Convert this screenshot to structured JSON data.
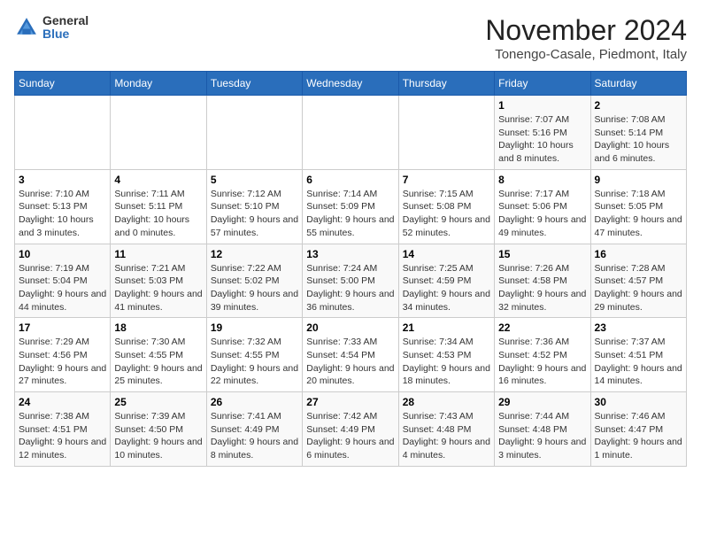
{
  "header": {
    "logo_general": "General",
    "logo_blue": "Blue",
    "month_title": "November 2024",
    "location": "Tonengo-Casale, Piedmont, Italy"
  },
  "days_of_week": [
    "Sunday",
    "Monday",
    "Tuesday",
    "Wednesday",
    "Thursday",
    "Friday",
    "Saturday"
  ],
  "weeks": [
    [
      {
        "day": "",
        "info": ""
      },
      {
        "day": "",
        "info": ""
      },
      {
        "day": "",
        "info": ""
      },
      {
        "day": "",
        "info": ""
      },
      {
        "day": "",
        "info": ""
      },
      {
        "day": "1",
        "info": "Sunrise: 7:07 AM\nSunset: 5:16 PM\nDaylight: 10 hours and 8 minutes."
      },
      {
        "day": "2",
        "info": "Sunrise: 7:08 AM\nSunset: 5:14 PM\nDaylight: 10 hours and 6 minutes."
      }
    ],
    [
      {
        "day": "3",
        "info": "Sunrise: 7:10 AM\nSunset: 5:13 PM\nDaylight: 10 hours and 3 minutes."
      },
      {
        "day": "4",
        "info": "Sunrise: 7:11 AM\nSunset: 5:11 PM\nDaylight: 10 hours and 0 minutes."
      },
      {
        "day": "5",
        "info": "Sunrise: 7:12 AM\nSunset: 5:10 PM\nDaylight: 9 hours and 57 minutes."
      },
      {
        "day": "6",
        "info": "Sunrise: 7:14 AM\nSunset: 5:09 PM\nDaylight: 9 hours and 55 minutes."
      },
      {
        "day": "7",
        "info": "Sunrise: 7:15 AM\nSunset: 5:08 PM\nDaylight: 9 hours and 52 minutes."
      },
      {
        "day": "8",
        "info": "Sunrise: 7:17 AM\nSunset: 5:06 PM\nDaylight: 9 hours and 49 minutes."
      },
      {
        "day": "9",
        "info": "Sunrise: 7:18 AM\nSunset: 5:05 PM\nDaylight: 9 hours and 47 minutes."
      }
    ],
    [
      {
        "day": "10",
        "info": "Sunrise: 7:19 AM\nSunset: 5:04 PM\nDaylight: 9 hours and 44 minutes."
      },
      {
        "day": "11",
        "info": "Sunrise: 7:21 AM\nSunset: 5:03 PM\nDaylight: 9 hours and 41 minutes."
      },
      {
        "day": "12",
        "info": "Sunrise: 7:22 AM\nSunset: 5:02 PM\nDaylight: 9 hours and 39 minutes."
      },
      {
        "day": "13",
        "info": "Sunrise: 7:24 AM\nSunset: 5:00 PM\nDaylight: 9 hours and 36 minutes."
      },
      {
        "day": "14",
        "info": "Sunrise: 7:25 AM\nSunset: 4:59 PM\nDaylight: 9 hours and 34 minutes."
      },
      {
        "day": "15",
        "info": "Sunrise: 7:26 AM\nSunset: 4:58 PM\nDaylight: 9 hours and 32 minutes."
      },
      {
        "day": "16",
        "info": "Sunrise: 7:28 AM\nSunset: 4:57 PM\nDaylight: 9 hours and 29 minutes."
      }
    ],
    [
      {
        "day": "17",
        "info": "Sunrise: 7:29 AM\nSunset: 4:56 PM\nDaylight: 9 hours and 27 minutes."
      },
      {
        "day": "18",
        "info": "Sunrise: 7:30 AM\nSunset: 4:55 PM\nDaylight: 9 hours and 25 minutes."
      },
      {
        "day": "19",
        "info": "Sunrise: 7:32 AM\nSunset: 4:55 PM\nDaylight: 9 hours and 22 minutes."
      },
      {
        "day": "20",
        "info": "Sunrise: 7:33 AM\nSunset: 4:54 PM\nDaylight: 9 hours and 20 minutes."
      },
      {
        "day": "21",
        "info": "Sunrise: 7:34 AM\nSunset: 4:53 PM\nDaylight: 9 hours and 18 minutes."
      },
      {
        "day": "22",
        "info": "Sunrise: 7:36 AM\nSunset: 4:52 PM\nDaylight: 9 hours and 16 minutes."
      },
      {
        "day": "23",
        "info": "Sunrise: 7:37 AM\nSunset: 4:51 PM\nDaylight: 9 hours and 14 minutes."
      }
    ],
    [
      {
        "day": "24",
        "info": "Sunrise: 7:38 AM\nSunset: 4:51 PM\nDaylight: 9 hours and 12 minutes."
      },
      {
        "day": "25",
        "info": "Sunrise: 7:39 AM\nSunset: 4:50 PM\nDaylight: 9 hours and 10 minutes."
      },
      {
        "day": "26",
        "info": "Sunrise: 7:41 AM\nSunset: 4:49 PM\nDaylight: 9 hours and 8 minutes."
      },
      {
        "day": "27",
        "info": "Sunrise: 7:42 AM\nSunset: 4:49 PM\nDaylight: 9 hours and 6 minutes."
      },
      {
        "day": "28",
        "info": "Sunrise: 7:43 AM\nSunset: 4:48 PM\nDaylight: 9 hours and 4 minutes."
      },
      {
        "day": "29",
        "info": "Sunrise: 7:44 AM\nSunset: 4:48 PM\nDaylight: 9 hours and 3 minutes."
      },
      {
        "day": "30",
        "info": "Sunrise: 7:46 AM\nSunset: 4:47 PM\nDaylight: 9 hours and 1 minute."
      }
    ]
  ]
}
